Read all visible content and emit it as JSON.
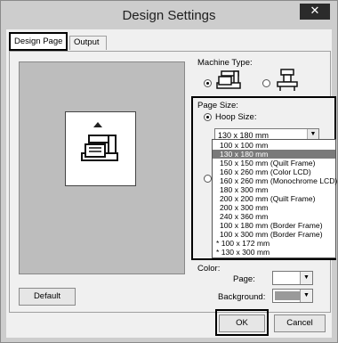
{
  "window": {
    "title": "Design Settings",
    "close_glyph": "✕"
  },
  "tabs": [
    {
      "label": "Design Page",
      "active": true
    },
    {
      "label": "Output",
      "active": false
    }
  ],
  "machine_type": {
    "label": "Machine Type:",
    "options": [
      {
        "icon": "embroidery-machine-icon",
        "selected": true
      },
      {
        "icon": "multi-needle-machine-icon",
        "selected": false
      }
    ]
  },
  "page_size": {
    "label": "Page Size:",
    "hoop_size_label": "Hoop Size:",
    "hoop_size_selected": true,
    "combo_value": "130 x 180 mm",
    "dropdown": [
      {
        "label": "100 x 100 mm",
        "selected": false
      },
      {
        "label": "130 x 180 mm",
        "selected": true
      },
      {
        "label": "150 x 150 mm (Quilt Frame)",
        "selected": false
      },
      {
        "label": "160 x 260 mm (Color LCD)",
        "selected": false
      },
      {
        "label": "160 x 260 mm (Monochrome LCD)",
        "selected": false
      },
      {
        "label": "180 x 300 mm",
        "selected": false
      },
      {
        "label": "200 x 200 mm (Quilt Frame)",
        "selected": false
      },
      {
        "label": "200 x 300 mm",
        "selected": false
      },
      {
        "label": "240 x 360 mm",
        "selected": false
      },
      {
        "label": "100 x 180 mm (Border Frame)",
        "selected": false
      },
      {
        "label": "100 x 300 mm (Border Frame)",
        "selected": false
      },
      {
        "label": "* 100 x 172 mm",
        "selected": false
      },
      {
        "label": "* 130 x 300 mm",
        "selected": false
      }
    ]
  },
  "color": {
    "label": "Color:",
    "page_label": "Page:",
    "page_color": "#ffffff",
    "background_label": "Background:",
    "background_color": "#9a9a9a"
  },
  "buttons": {
    "default": "Default",
    "ok": "OK",
    "cancel": "Cancel"
  }
}
